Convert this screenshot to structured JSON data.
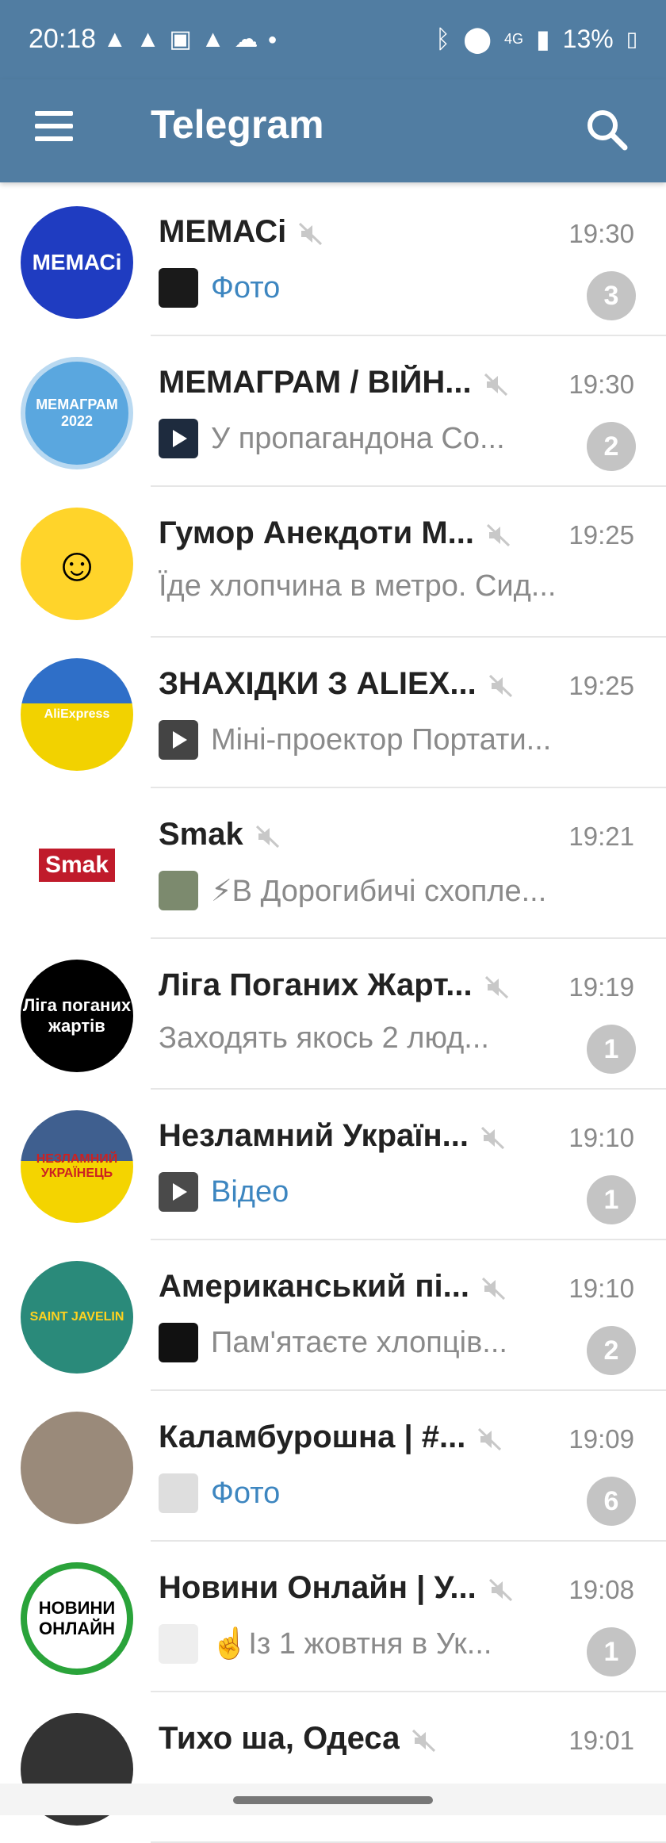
{
  "status": {
    "time": "20:18",
    "network": "4G",
    "battery": "13%",
    "left_icons": [
      "navigation-icon",
      "navigation-icon",
      "image-icon",
      "navigation-icon",
      "cloud-icon",
      "dot-icon"
    ],
    "right_icons": [
      "bluetooth-icon",
      "location-icon",
      "signal-icon",
      "battery-icon"
    ]
  },
  "toolbar": {
    "title": "Telegram",
    "menu_icon": "hamburger-menu-icon",
    "search_icon": "search-icon"
  },
  "colors": {
    "header": "#517da2",
    "accent_text": "#3d86c0",
    "badge": "#c4c4c4"
  },
  "chats": [
    {
      "name": "МЕМАСі",
      "time": "19:30",
      "preview": "Фото",
      "preview_style": "blue",
      "unread": "3",
      "muted": true,
      "avatar_text": "МЕМАСі"
    },
    {
      "name": "МЕМАГРАМ / ВІЙН...",
      "time": "19:30",
      "preview": "У пропагандона Со...",
      "preview_style": "grey",
      "unread": "2",
      "muted": true,
      "avatar_text": "МЕМАГРАМ 2022"
    },
    {
      "name": "Гумор Анекдоти М...",
      "time": "19:25",
      "preview": "Їде хлопчина в метро. Сид...",
      "preview_style": "grey",
      "unread": "",
      "muted": true,
      "avatar_text": ""
    },
    {
      "name": "ЗНАХІДКИ З ALIEX...",
      "time": "19:25",
      "preview": "Міні-проектор Портати...",
      "preview_style": "grey",
      "unread": "",
      "muted": true,
      "avatar_text": "AliExpress"
    },
    {
      "name": "Smak",
      "time": "19:21",
      "preview": "⚡В Дорогибичі схопле...",
      "preview_style": "grey",
      "unread": "",
      "muted": true,
      "avatar_text": "Smak"
    },
    {
      "name": "Ліга Поганих Жарт...",
      "time": "19:19",
      "preview": "Заходять якось 2 люд...",
      "preview_style": "grey",
      "unread": "1",
      "muted": true,
      "avatar_text": "Ліга поганих жартів"
    },
    {
      "name": "Незламний Україн...",
      "time": "19:10",
      "preview": "Відео",
      "preview_style": "blue",
      "unread": "1",
      "muted": true,
      "avatar_text": "НЕЗЛАМНИЙ УКРАЇНЕЦЬ"
    },
    {
      "name": "Американський пі...",
      "time": "19:10",
      "preview": "Пам'ятаєте хлопців...",
      "preview_style": "grey",
      "unread": "2",
      "muted": true,
      "avatar_text": "SAINT JAVELIN"
    },
    {
      "name": "Каламбурошна | #...",
      "time": "19:09",
      "preview": "Фото",
      "preview_style": "blue",
      "unread": "6",
      "muted": true,
      "avatar_text": ""
    },
    {
      "name": "Новини Онлайн | У...",
      "time": "19:08",
      "preview": "☝️Із 1 жовтня в Ук...",
      "preview_style": "grey",
      "unread": "1",
      "muted": true,
      "avatar_text": "НОВИНИ ОНЛАЙН"
    },
    {
      "name": "Тихо ша, Одеса",
      "time": "19:01",
      "preview": "",
      "preview_style": "grey",
      "unread": "",
      "muted": true,
      "avatar_text": ""
    }
  ]
}
